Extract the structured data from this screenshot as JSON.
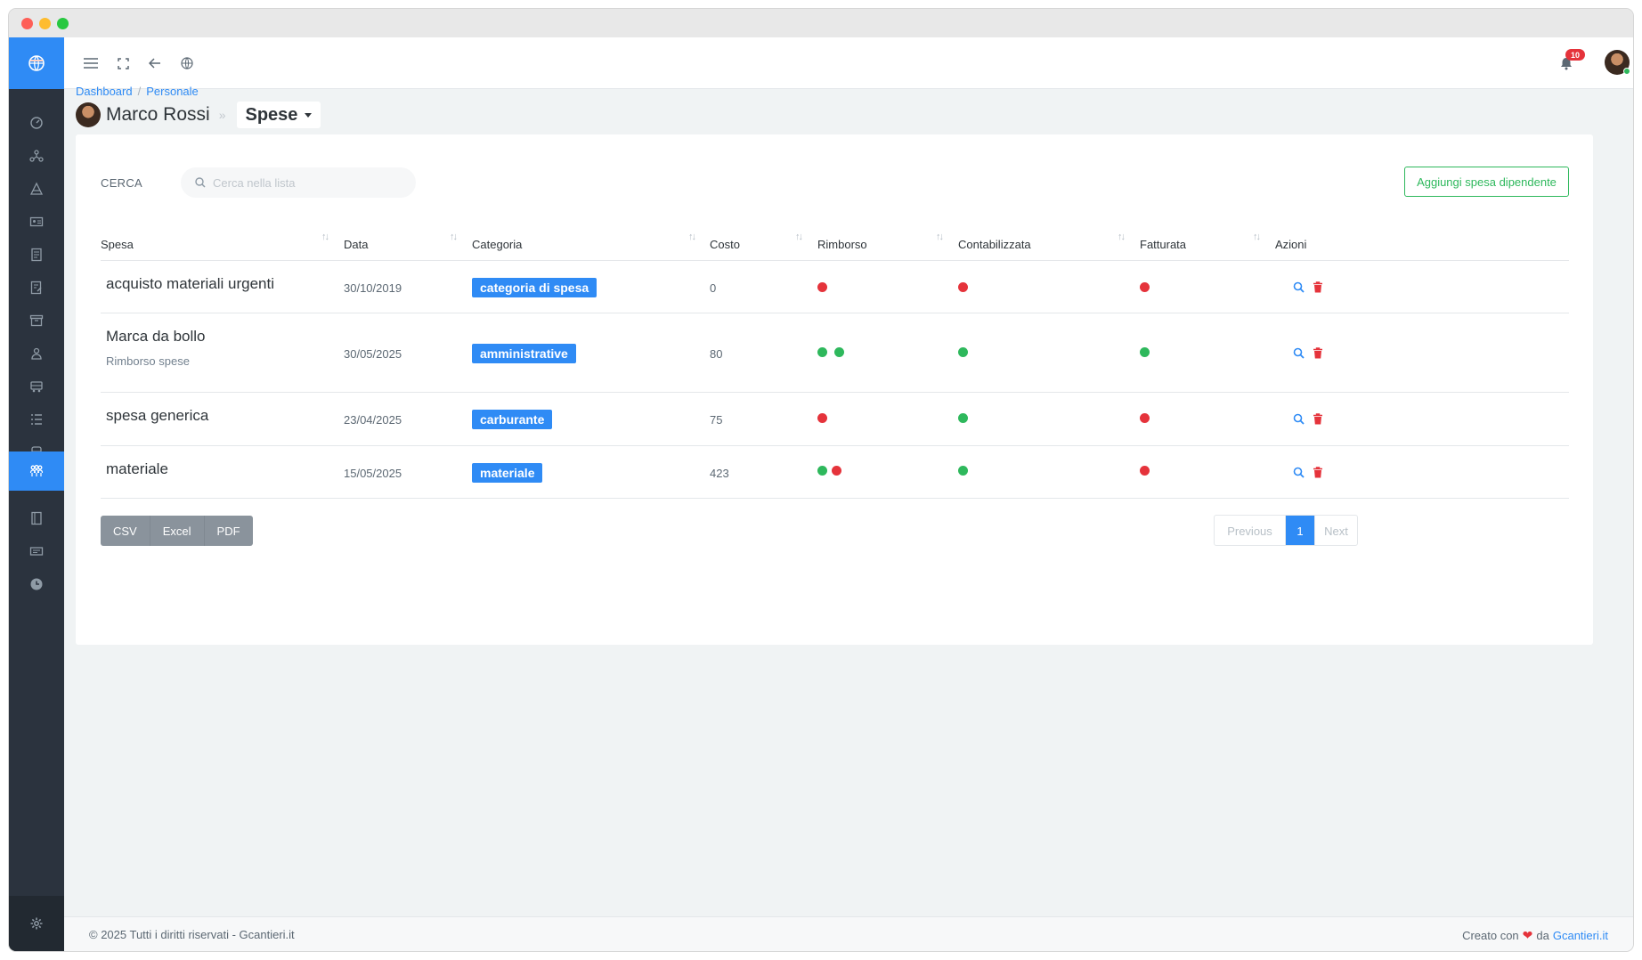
{
  "topbar": {
    "notifications_count": "10"
  },
  "breadcrumb": {
    "items": [
      "Dashboard",
      "Personale"
    ],
    "separator": "/"
  },
  "employee": {
    "name": "Marco Rossi",
    "arrow": "»",
    "section": "Spese"
  },
  "search": {
    "label": "CERCA",
    "placeholder": "Cerca nella lista"
  },
  "add_button": "Aggiungi spesa dipendente",
  "table": {
    "columns": [
      "Spesa",
      "Data",
      "Categoria",
      "Costo",
      "Rimborso",
      "Contabilizzata",
      "Fatturata",
      "Azioni"
    ],
    "rows": [
      {
        "title": "acquisto materiali urgenti",
        "subtitle": "",
        "date": "30/10/2019",
        "category": "categoria di spesa",
        "cost": "0",
        "rimborso": [
          "red"
        ],
        "contabilizzata": "red",
        "fatturata": "red"
      },
      {
        "title": "Marca da bollo",
        "subtitle": "Rimborso spese",
        "date": "30/05/2025",
        "category": "amministrative",
        "cost": "80",
        "rimborso": [
          "green",
          "green"
        ],
        "contabilizzata": "green",
        "fatturata": "green"
      },
      {
        "title": "spesa generica",
        "subtitle": "",
        "date": "23/04/2025",
        "category": "carburante",
        "cost": "75",
        "rimborso": [
          "red"
        ],
        "contabilizzata": "green",
        "fatturata": "red"
      },
      {
        "title": "materiale",
        "subtitle": "",
        "date": "15/05/2025",
        "category": "materiale",
        "cost": "423",
        "rimborso": [
          "green",
          "red"
        ],
        "contabilizzata": "green",
        "fatturata": "red"
      }
    ]
  },
  "export": {
    "csv": "CSV",
    "excel": "Excel",
    "pdf": "PDF"
  },
  "pagination": {
    "previous": "Previous",
    "current": "1",
    "next": "Next"
  },
  "footer": {
    "left": "© 2025 Tutti i diritti riservati - Gcantieri.it",
    "right_prefix": "Creato con",
    "heart": "❤",
    "right_mid": "da",
    "right_link": "Gcantieri.it"
  },
  "colors": {
    "primary": "#2f8bf5",
    "success": "#2eb85c",
    "danger": "#e5333b",
    "sidebar": "#2b333e"
  },
  "sidebar_icons": [
    "dashboard-icon",
    "network-icon",
    "pyramid-icon",
    "id-card-icon",
    "document-icon",
    "edit-document-icon",
    "archive-icon",
    "users-icon",
    "vehicle-icon",
    "list-icon",
    "bus-icon",
    "team-icon",
    "book-icon",
    "ticket-icon",
    "clock-icon",
    "gear-icon"
  ]
}
